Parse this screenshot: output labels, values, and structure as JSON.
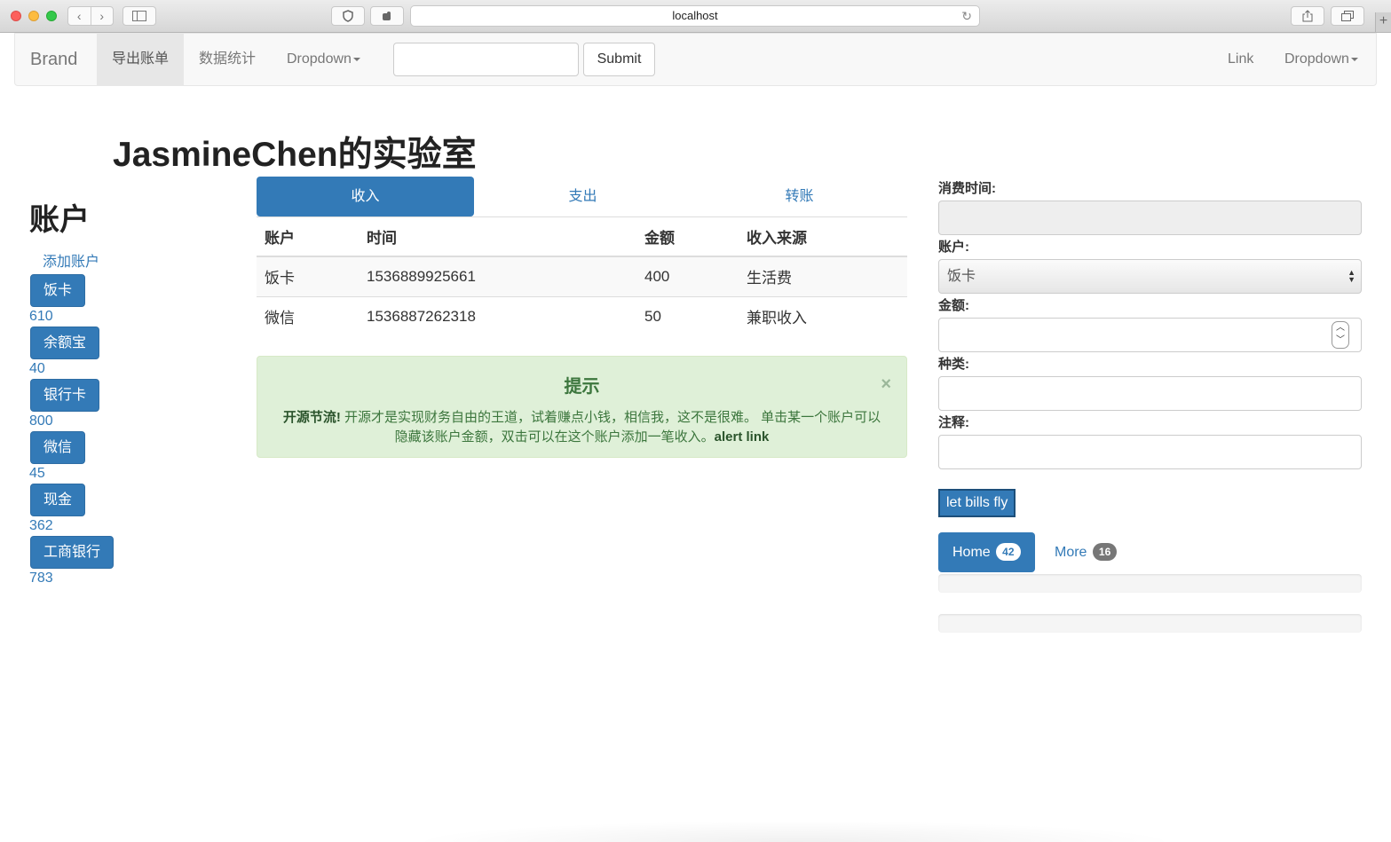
{
  "browser": {
    "url": "localhost",
    "back_icon": "chevron-left-icon",
    "forward_icon": "chevron-right-icon"
  },
  "navbar": {
    "brand": "Brand",
    "items": [
      {
        "label": "导出账单",
        "active": true
      },
      {
        "label": "数据统计",
        "active": false
      },
      {
        "label": "Dropdown",
        "active": false
      }
    ],
    "search_value": "",
    "submit_label": "Submit",
    "right_link": "Link",
    "right_dropdown": "Dropdown"
  },
  "page": {
    "title": "JasmineChen的实验室"
  },
  "sidebar": {
    "heading": "账户",
    "add_label": "添加账户",
    "accounts": [
      {
        "name": "饭卡",
        "amount": "610"
      },
      {
        "name": "余额宝",
        "amount": "40"
      },
      {
        "name": "银行卡",
        "amount": "800"
      },
      {
        "name": "微信",
        "amount": "45"
      },
      {
        "name": "现金",
        "amount": "362"
      },
      {
        "name": "工商银行",
        "amount": "783"
      }
    ]
  },
  "tabs": [
    {
      "label": "收入",
      "active": true
    },
    {
      "label": "支出",
      "active": false
    },
    {
      "label": "转账",
      "active": false
    }
  ],
  "table": {
    "headers": [
      "账户",
      "时间",
      "金额",
      "收入来源"
    ],
    "rows": [
      [
        "饭卡",
        "1536889925661",
        "400",
        "生活费"
      ],
      [
        "微信",
        "1536887262318",
        "50",
        "兼职收入"
      ]
    ]
  },
  "alert": {
    "title": "提示",
    "strong": "开源节流!",
    "body": " 开源才是实现财务自由的王道，试着赚点小钱，相信我，这不是很难。 单击某一个账户可以隐藏该账户金额，双击可以在这个账户添加一笔收入。",
    "link": "alert link",
    "close": "×"
  },
  "form": {
    "time_label": "消费时间:",
    "time_value": "",
    "account_label": "账户:",
    "account_selected": "饭卡",
    "amount_label": "金额:",
    "amount_value": "",
    "category_label": "种类:",
    "category_value": "",
    "note_label": "注释:",
    "note_value": "",
    "submit_label": "let bills fly"
  },
  "pills": [
    {
      "label": "Home",
      "badge": "42",
      "active": true
    },
    {
      "label": "More",
      "badge": "16",
      "active": false
    }
  ],
  "progress_bars": [
    0,
    0
  ],
  "colors": {
    "primary": "#337ab7",
    "success_bg": "#dff0d8",
    "success_text": "#3c763d"
  }
}
